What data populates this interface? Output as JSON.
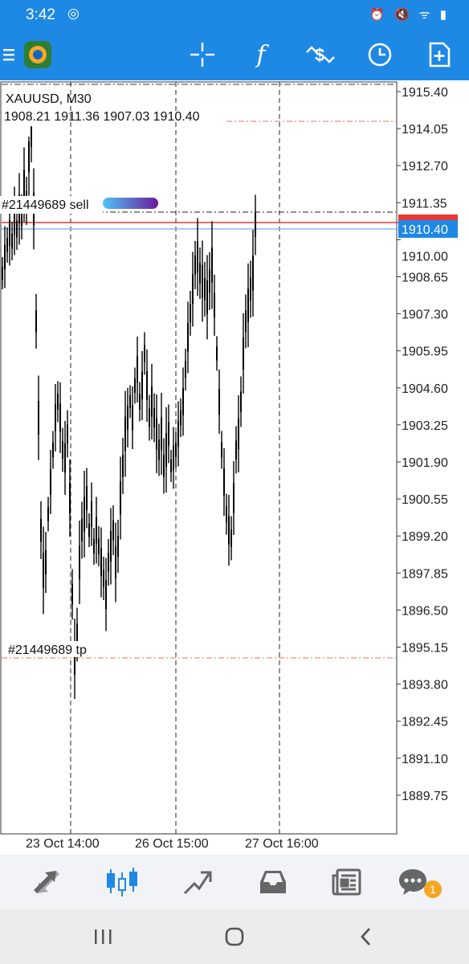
{
  "status_bar": {
    "time": "3:42",
    "right_icons": "⏰ 🔇 ᯤ ▮"
  },
  "toolbar": {
    "icons": [
      "menu-icon",
      "app-logo-icon",
      "crosshair-icon",
      "indicators-icon",
      "trade-icon",
      "history-clock-icon",
      "new-order-icon"
    ]
  },
  "chart": {
    "symbol_header": "XAUUSD, M30",
    "ohlc": "1908.21 1911.36 1907.03 1910.40",
    "sell_label": "#21449689 sell",
    "tp_label": "#21449689 tp",
    "price_ticks": [
      "1915.40",
      "1914.05",
      "1912.70",
      "1911.35",
      "1910.00",
      "1908.65",
      "1907.30",
      "1905.95",
      "1904.60",
      "1903.25",
      "1901.90",
      "1900.55",
      "1899.20",
      "1897.85",
      "1896.50",
      "1895.15",
      "1893.80",
      "1892.45",
      "1891.10",
      "1889.75"
    ],
    "bid_price": "1910.40",
    "ask_price_hidden": "1910.50",
    "time_ticks": [
      "23 Oct 14:00",
      "26 Oct 15:00",
      "27 Oct 16:00"
    ],
    "colors": {
      "bid": "#1e88e5",
      "ask": "#e53935",
      "level": "#e57356",
      "candle": "#000000"
    }
  },
  "bottom_nav": {
    "items": [
      "quotes-icon",
      "chart-icon",
      "trade-icon",
      "history-icon",
      "news-icon",
      "messages-icon"
    ],
    "messages_badge": "1",
    "active_index": 1
  }
}
